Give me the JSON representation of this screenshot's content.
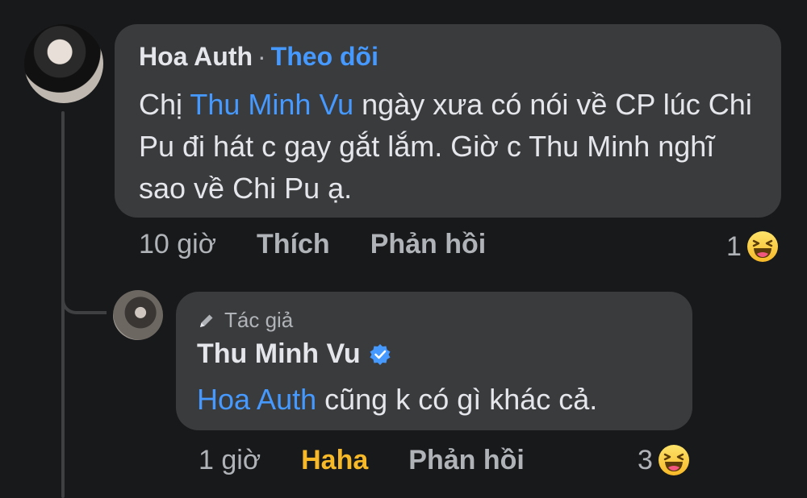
{
  "comment": {
    "author": "Hoa Auth",
    "separator": "·",
    "follow_label": "Theo dõi",
    "text_before_mention": "Chị ",
    "mention": "Thu Minh Vu",
    "text_after_mention": "  ngày xưa có nói về CP lúc Chi Pu đi hát c gay gắt lắm. Giờ c Thu Minh nghĩ sao về Chi Pu ạ.",
    "time": "10 giờ",
    "like_label": "Thích",
    "reply_label": "Phản hồi",
    "reaction_count": "1",
    "reaction_icon": "haha-icon"
  },
  "reply": {
    "badge": "Tác giả",
    "author": "Thu Minh Vu",
    "verified_icon": "verified-icon",
    "mention": "Hoa Auth",
    "text_after_mention": " cũng k có gì khác cả.",
    "time": "1 giờ",
    "reaction_label": "Haha",
    "reply_label": "Phản hồi",
    "reaction_count": "3",
    "reaction_icon": "haha-icon"
  },
  "colors": {
    "background": "#18191a",
    "bubble": "#3a3b3c",
    "link": "#4599ff",
    "haha": "#f7b928",
    "secondary_text": "#b0b3b8"
  }
}
